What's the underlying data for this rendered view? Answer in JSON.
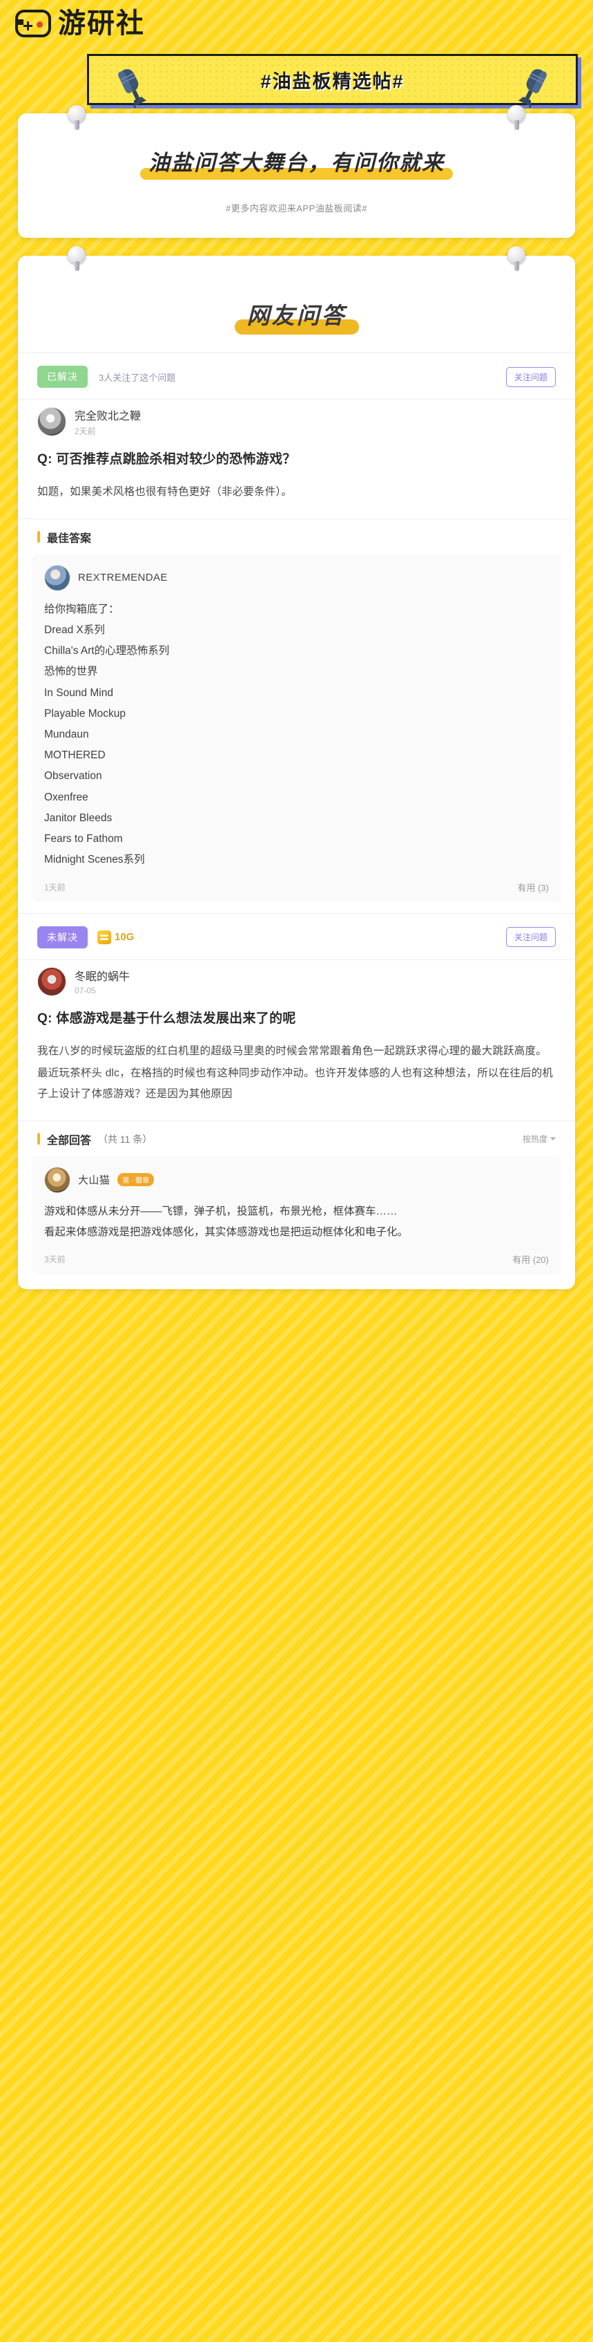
{
  "site": {
    "logo_text": "游研社",
    "logo_icon": "gamepad-icon"
  },
  "banner": {
    "hashtag": "#油盐板精选帖#",
    "mic_icon_left": "microphone-icon",
    "mic_icon_right": "microphone-icon"
  },
  "intro": {
    "title": "油盐问答大舞台，有问你就来",
    "subtitle": "#更多内容欢迎来APP油盐板阅读#"
  },
  "qa_section": {
    "heading": "网友问答"
  },
  "questions": [
    {
      "status_label": "已解决",
      "status_kind": "solved",
      "follow_count_text": "3人关注了这个问题",
      "follow_button": "关注问题",
      "author": "完全败北之鞭",
      "author_avatar": "user-avatar",
      "time": "2天前",
      "title": "Q: 可否推荐点跳脸杀相对较少的恐怖游戏？",
      "body": [
        "如题，如果美术风格也很有特色更好（非必要条件）。"
      ],
      "answers_label": "最佳答案",
      "answers": [
        {
          "name": "REXTREMENDAE",
          "avatar": "user-avatar",
          "lines": [
            "给你掏箱底了：",
            "Dread X系列",
            "Chilla's Art的心理恐怖系列",
            "恐怖的世界",
            "In Sound Mind",
            "Playable Mockup",
            "Mundaun",
            "MOTHERED",
            "Observation",
            "Oxenfree",
            "Janitor Bleeds",
            "Fears to Fathom",
            "Midnight Scenes系列"
          ],
          "time": "1天前",
          "useful": "有用 (3)"
        }
      ]
    },
    {
      "status_label": "未解决",
      "status_kind": "unsolved",
      "gold_icon": "coin-icon",
      "gold_amount": "10G",
      "follow_button": "关注问题",
      "author": "冬眠的蜗牛",
      "author_avatar": "user-avatar",
      "time": "07-05",
      "title": "Q: 体感游戏是基于什么想法发展出来了的呢",
      "body": [
        "我在八岁的时候玩盗版的红白机里的超级马里奥的时候会常常跟着角色一起跳跃求得心理的最大跳跃高度。",
        "最近玩茶杯头 dlc，在格挡的时候也有这种同步动作冲动。也许开发体感的人也有这种想法，所以在往后的机子上设计了体感游戏？还是因为其他原因"
      ],
      "answers_label": "全部回答",
      "answers_count": "（共 11 条）",
      "sort_label": "按热度",
      "answers": [
        {
          "name": "大山猫",
          "avatar": "user-avatar",
          "tag": "第 · 徽章",
          "lines": [
            "游戏和体感从未分开——飞镖，弹子机，投篮机，布景光枪，框体赛车……",
            "看起来体感游戏是把游戏体感化，其实体感游戏也是把运动框体化和电子化。"
          ],
          "time": "3天前",
          "useful": "有用 (20)"
        }
      ]
    }
  ],
  "colors": {
    "page_bg": "#FFD91E",
    "banner_bg": "#FCE850",
    "accent_yellow": "#F0B823",
    "solved_green": "#8FD68E",
    "unsolved_purple": "#9A85F0",
    "gold": "#E0A21D"
  }
}
